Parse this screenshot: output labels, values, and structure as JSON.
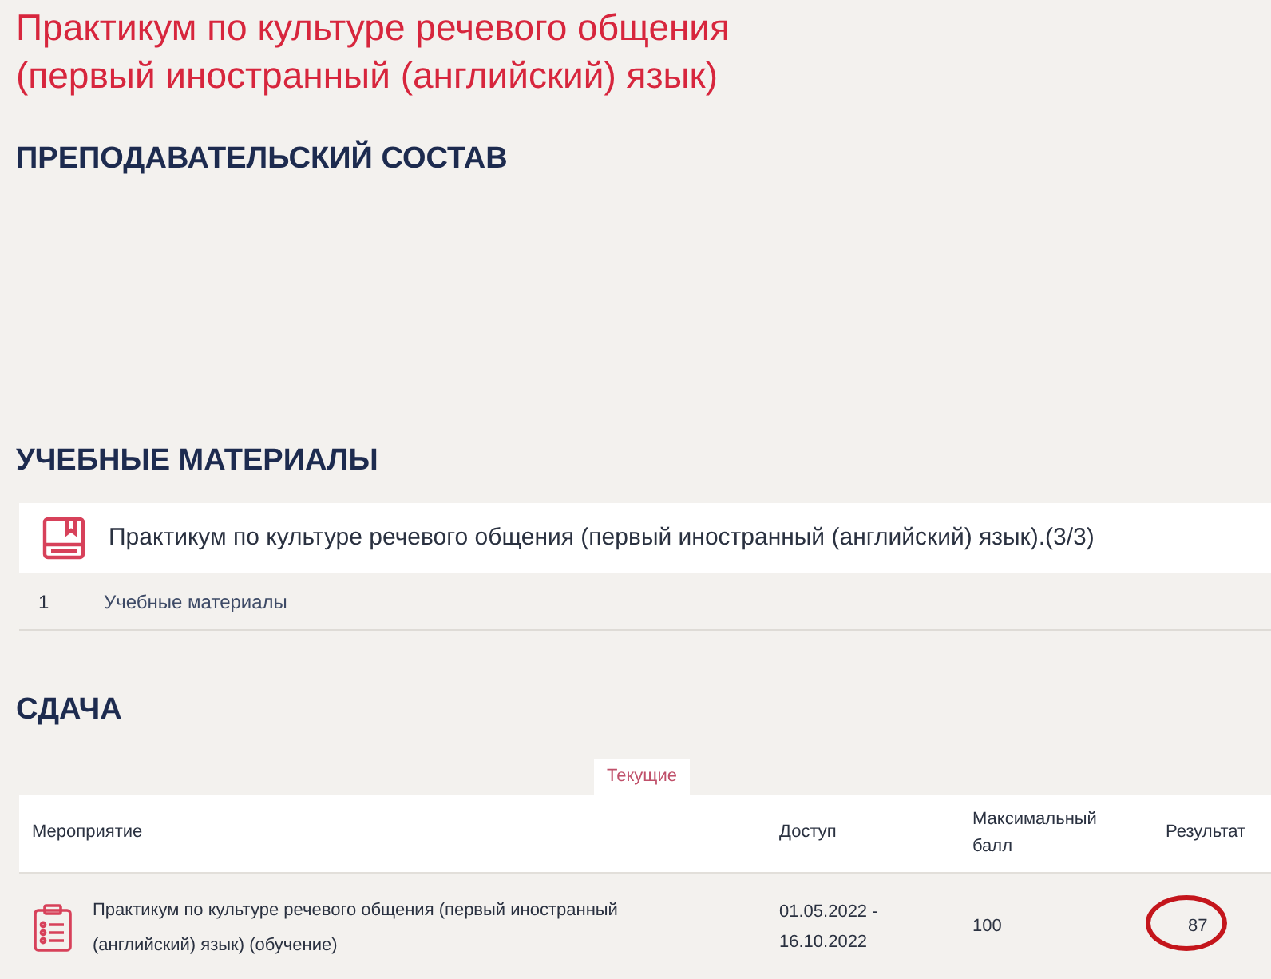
{
  "title": "Практикум по культуре речевого общения (первый иностранный (английский) язык)",
  "teachers": {
    "heading": "ПРЕПОДАВАТЕЛЬСКИЙ СОСТАВ"
  },
  "materials": {
    "heading": "УЧЕБНЫЕ МАТЕРИАЛЫ",
    "card_title": "Практикум по культуре речевого общения (первый иностранный (английский) язык).(3/3)",
    "rows": [
      {
        "number": "1",
        "name": "Учебные материалы"
      }
    ]
  },
  "submission": {
    "heading": "СДАЧА",
    "tabs": [
      {
        "label": "Текущие",
        "selected": true
      }
    ],
    "table": {
      "columns": [
        "Мероприятие",
        "Доступ",
        "Максимальный балл",
        "Результат"
      ],
      "rows": [
        {
          "event": "Практикум по культуре речевого общения (первый иностранный (английский) язык) (обучение)",
          "access": "01.05.2022 - 16.10.2022",
          "max_score": "100",
          "result": "87",
          "result_circled": true
        }
      ]
    }
  }
}
